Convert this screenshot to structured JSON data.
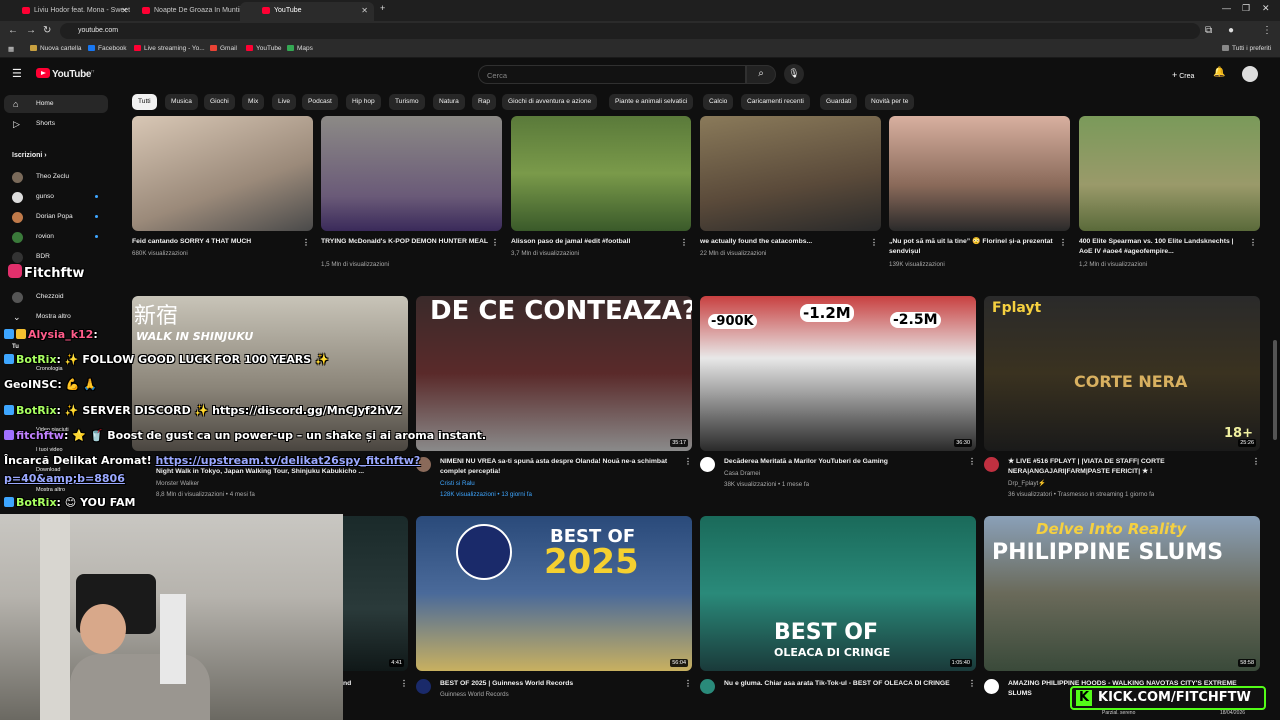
{
  "browser": {
    "tabs": [
      {
        "title": "Liviu Hodor feat. Mona - Sweet"
      },
      {
        "title": "Noapte De Groaza In Muntii Pi"
      },
      {
        "title": "YouTube"
      }
    ],
    "new_tab": "+",
    "url": "youtube.com",
    "bookmarks": [
      "Nuova cartella",
      "Facebook",
      "Live streaming - Yo...",
      "Gmail",
      "YouTube",
      "Maps"
    ],
    "all_favorites": "Tutti i preferiti"
  },
  "masthead": {
    "logo": "YouTube",
    "logo_region": "IT",
    "search_placeholder": "Cerca",
    "create_label": "Crea"
  },
  "chips": [
    "Tutti",
    "Musica",
    "Giochi",
    "Mix",
    "Live",
    "Podcast",
    "Hip hop",
    "Turismo",
    "Natura",
    "Rap",
    "Giochi di avventura e azione",
    "Piante e animali selvatici",
    "Calcio",
    "Caricamenti recenti",
    "Guardati",
    "Novità per te"
  ],
  "sidebar": {
    "home": "Home",
    "shorts": "Shorts",
    "subscriptions_header": "Iscrizioni",
    "subscriptions": [
      "Theo Zeclu",
      "gunso",
      "Dorian Popa",
      "rovion",
      "BDR",
      "Chezzoid"
    ],
    "show_more": "Mostra altro",
    "you_header": "Tu",
    "you_items": [
      "Cronologia",
      "Video piaciuti",
      "I tuoi video",
      "Download"
    ],
    "show_more_2": "Mostra altro"
  },
  "row1": [
    {
      "title": "Feid cantando SORRY 4 THAT MUCH",
      "meta": "680K visualizzazioni"
    },
    {
      "title": "TRYING McDonald's K-POP DEMON HUNTER MEAL",
      "meta": "1,5 Mln di visualizzazioni"
    },
    {
      "title": "Alisson paso de jamal #edit #football",
      "meta": "3,7 Mln di visualizzazioni"
    },
    {
      "title": "we actually found the catacombs...",
      "meta": "22 Mln di visualizzazioni"
    },
    {
      "title": "„Nu pot să mă uit la tine” 😳 Florinel și-a prezentat sendvișul",
      "meta": "139K visualizzazioni"
    },
    {
      "title": "400 Elite Spearman vs. 100 Elite Landsknechts | AoE IV #aoe4 #ageofempire...",
      "meta": "1,2 Mln di visualizzazioni"
    }
  ],
  "row2": [
    {
      "title": "Night Walk in Tokyo, Japan Walking Tour, Shinjuku Kabukicho ...",
      "channel": "Monster Walker",
      "meta": "8,8 Mln di visualizzazioni • 4 mesi fa",
      "thumb_text_1": "新宿",
      "thumb_text_2": "WALK IN SHINJUKU"
    },
    {
      "title": "NIMENI NU VREA sa-ti spună asta despre Olanda! Nouă ne-a schimbat complet perceptia!",
      "channel": "Cristi si Ralu",
      "meta": "128K visualizzazioni • 13 giorni fa",
      "duration": "35:17",
      "thumb_text": "DE CE CONTEAZA?"
    },
    {
      "title": "Decăderea Meritată a Marilor YouTuberi de Gaming",
      "channel": "Casa Dramei",
      "meta": "38K visualizzazioni • 1 mese fa",
      "duration": "36:30",
      "badges": [
        "-900K",
        "-1.2M",
        "-2.5M"
      ]
    },
    {
      "title": "★ LIVE #516 FPLAYT | |VIATA DE STAFF| CORTE NERA|ANGAJARI|FARM|PASTE FERICIT| ★ !",
      "channel": "Drp_Fplayt⚡",
      "meta": "36 visualizzatori • Trasmesso in streaming 1 giorno fa",
      "duration": "25:26",
      "thumb_text_1": "Fplayt",
      "thumb_text_2": "CORTE NERA",
      "thumb_text_3": "18+"
    }
  ],
  "row3": [
    {
      "title": "nd",
      "duration": "4:41"
    },
    {
      "title": "BEST OF 2025 | Guinness World Records",
      "channel": "Guinness World Records",
      "duration": "56:04",
      "thumb_text_1": "BEST OF",
      "thumb_text_2": "2025"
    },
    {
      "title": "Nu e gluma. Chiar asa arata Tik-Tok-ul - BEST OF OLEACA DI CRINGE",
      "duration": "1:05:40",
      "thumb_text_1": "BEST OF",
      "thumb_text_2": "OLEACA DI CRINGE"
    },
    {
      "title": "AMAZING PHILIPPINE HOODS - WALKING NAVOTAS CITY'S EXTREME SLUMS",
      "duration": "58:58",
      "thumb_text_1": "Delve Into Reality",
      "thumb_text_2": "PHILIPPINE SLUMS"
    }
  ],
  "overlay": {
    "channel_name": "Fitchftw",
    "chat": [
      {
        "user": "Alysia_k12",
        "sep": ":",
        "text": ""
      },
      {
        "user": "BotRix",
        "sep": ":",
        "text": "✨ FOLLOW GOOD LUCK FOR 100 YEARS ✨"
      },
      {
        "user": "GeoINSC",
        "sep": ":",
        "text": "💪 🙏"
      },
      {
        "user": "BotRix",
        "sep": ":",
        "text": "✨ SERVER DISCORD ✨ https://discord.gg/MnCJyf2hVZ"
      },
      {
        "user": "fitchftw",
        "sep": ":",
        "text": "⭐ 🥤 Boost de gust ca un power-up – un shake și ai aroma instant."
      },
      {
        "user": "",
        "sep": "",
        "text": "Încarcă Delikat Aromat!",
        "link": "https://upstream.tv/delikat26spy_fitchftw?p=40&amp;b=8806"
      },
      {
        "user": "BotRix",
        "sep": ":",
        "text": "😊 YOU FAM"
      }
    ],
    "kick_text": "KICK.COM/FITCHFTW",
    "taskbar_weather": "Parzial. sereno",
    "taskbar_date": "18/04/2026"
  },
  "colors": {
    "brand_red": "#ff0033",
    "kick_green": "#53fc18",
    "bg": "#0f0f0f",
    "chip": "#272727"
  }
}
